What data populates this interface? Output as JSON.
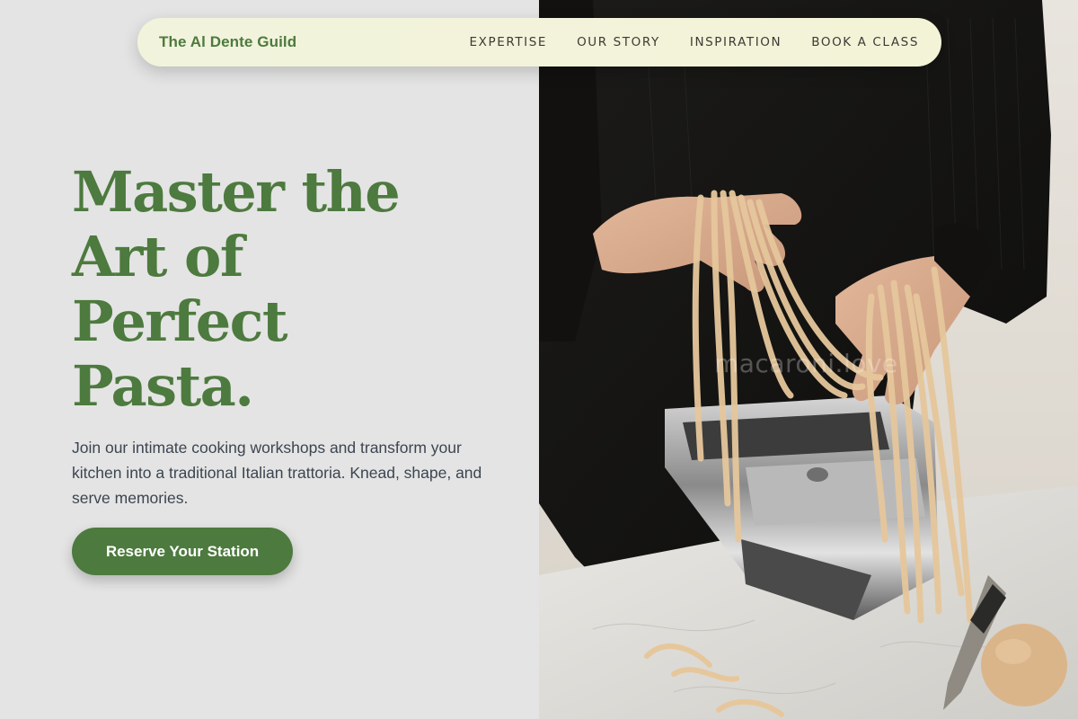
{
  "nav": {
    "brand": "The Al Dente Guild",
    "links": [
      "EXPERTISE",
      "OUR STORY",
      "INSPIRATION",
      "BOOK A CLASS"
    ]
  },
  "hero": {
    "title_lines": [
      "Master the",
      "Art of",
      "Perfect",
      "Pasta."
    ],
    "description": "Join our intimate cooking workshops and transform your kitchen into a traditional Italian trattoria. Knead, shape, and serve memories.",
    "cta_label": "Reserve Your Station"
  },
  "photo": {
    "watermark": "macaroni.love"
  },
  "colors": {
    "accent": "#4d7a3e",
    "nav_bg": "#f2f3dc",
    "page_bg": "#e4e4e4",
    "body_text": "#3c4550"
  }
}
